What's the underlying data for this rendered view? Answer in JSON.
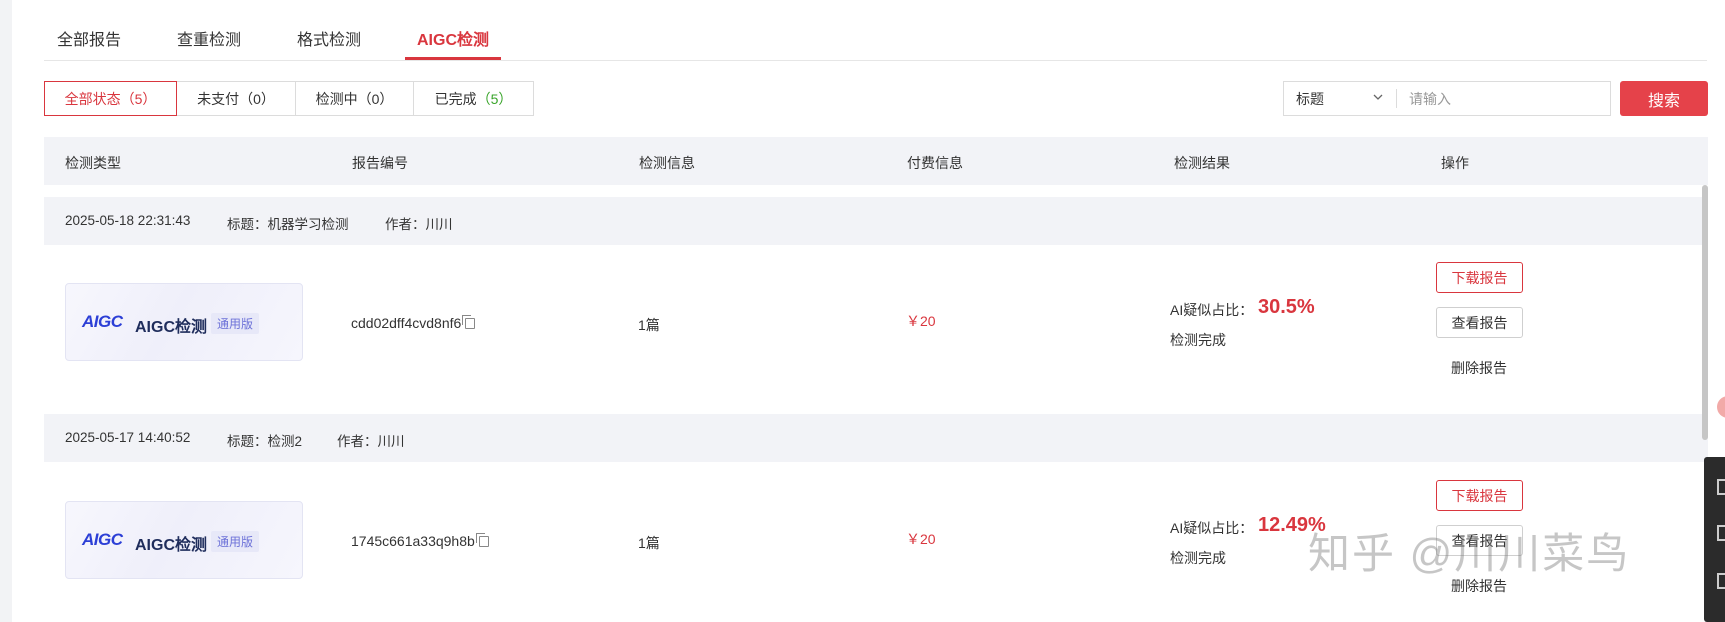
{
  "tabs": [
    {
      "label": "全部报告",
      "active": false
    },
    {
      "label": "查重检测",
      "active": false
    },
    {
      "label": "格式检测",
      "active": false
    },
    {
      "label": "AIGC检测",
      "active": true
    }
  ],
  "filters": [
    {
      "label": "全部状态",
      "count": "（5）",
      "active": true
    },
    {
      "label": "未支付",
      "count": "（0）",
      "active": false
    },
    {
      "label": "检测中",
      "count": "（0）",
      "active": false
    },
    {
      "label": "已完成",
      "count": "（5）",
      "active": false
    }
  ],
  "search": {
    "select_value": "标题",
    "placeholder": "请输入",
    "button_label": "搜索"
  },
  "table": {
    "headers": [
      "检测类型",
      "报告编号",
      "检测信息",
      "付费信息",
      "检测结果",
      "操作"
    ]
  },
  "records": [
    {
      "datetime": "2025-05-18 22:31:43",
      "title_label": "标题：",
      "title": "机器学习检测",
      "author_label": "作者：",
      "author": "川川",
      "card": {
        "logo": "AIGC",
        "name": "AIGC检测",
        "badge": "通用版"
      },
      "report_no": "cdd02dff4cvd8nf6",
      "info": "1篇",
      "price": "￥20",
      "ai_label": "AI疑似占比：",
      "ai_percent": "30.5%",
      "status": "检测完成",
      "actions": {
        "download": "下载报告",
        "view": "查看报告",
        "delete": "删除报告"
      }
    },
    {
      "datetime": "2025-05-17 14:40:52",
      "title_label": "标题：",
      "title": "检测2",
      "author_label": "作者：",
      "author": "川川",
      "card": {
        "logo": "AIGC",
        "name": "AIGC检测",
        "badge": "通用版"
      },
      "report_no": "1745c661a33q9h8b",
      "info": "1篇",
      "price": "￥20",
      "ai_label": "AI疑似占比：",
      "ai_percent": "12.49%",
      "status": "检测完成",
      "actions": {
        "download": "下载报告",
        "view": "查看报告",
        "delete": "删除报告"
      }
    }
  ],
  "watermark": "知乎 @川川菜鸟",
  "colors": {
    "accent": "#d9363e",
    "header_bg": "#f2f3f7",
    "success": "#3aa52b"
  }
}
